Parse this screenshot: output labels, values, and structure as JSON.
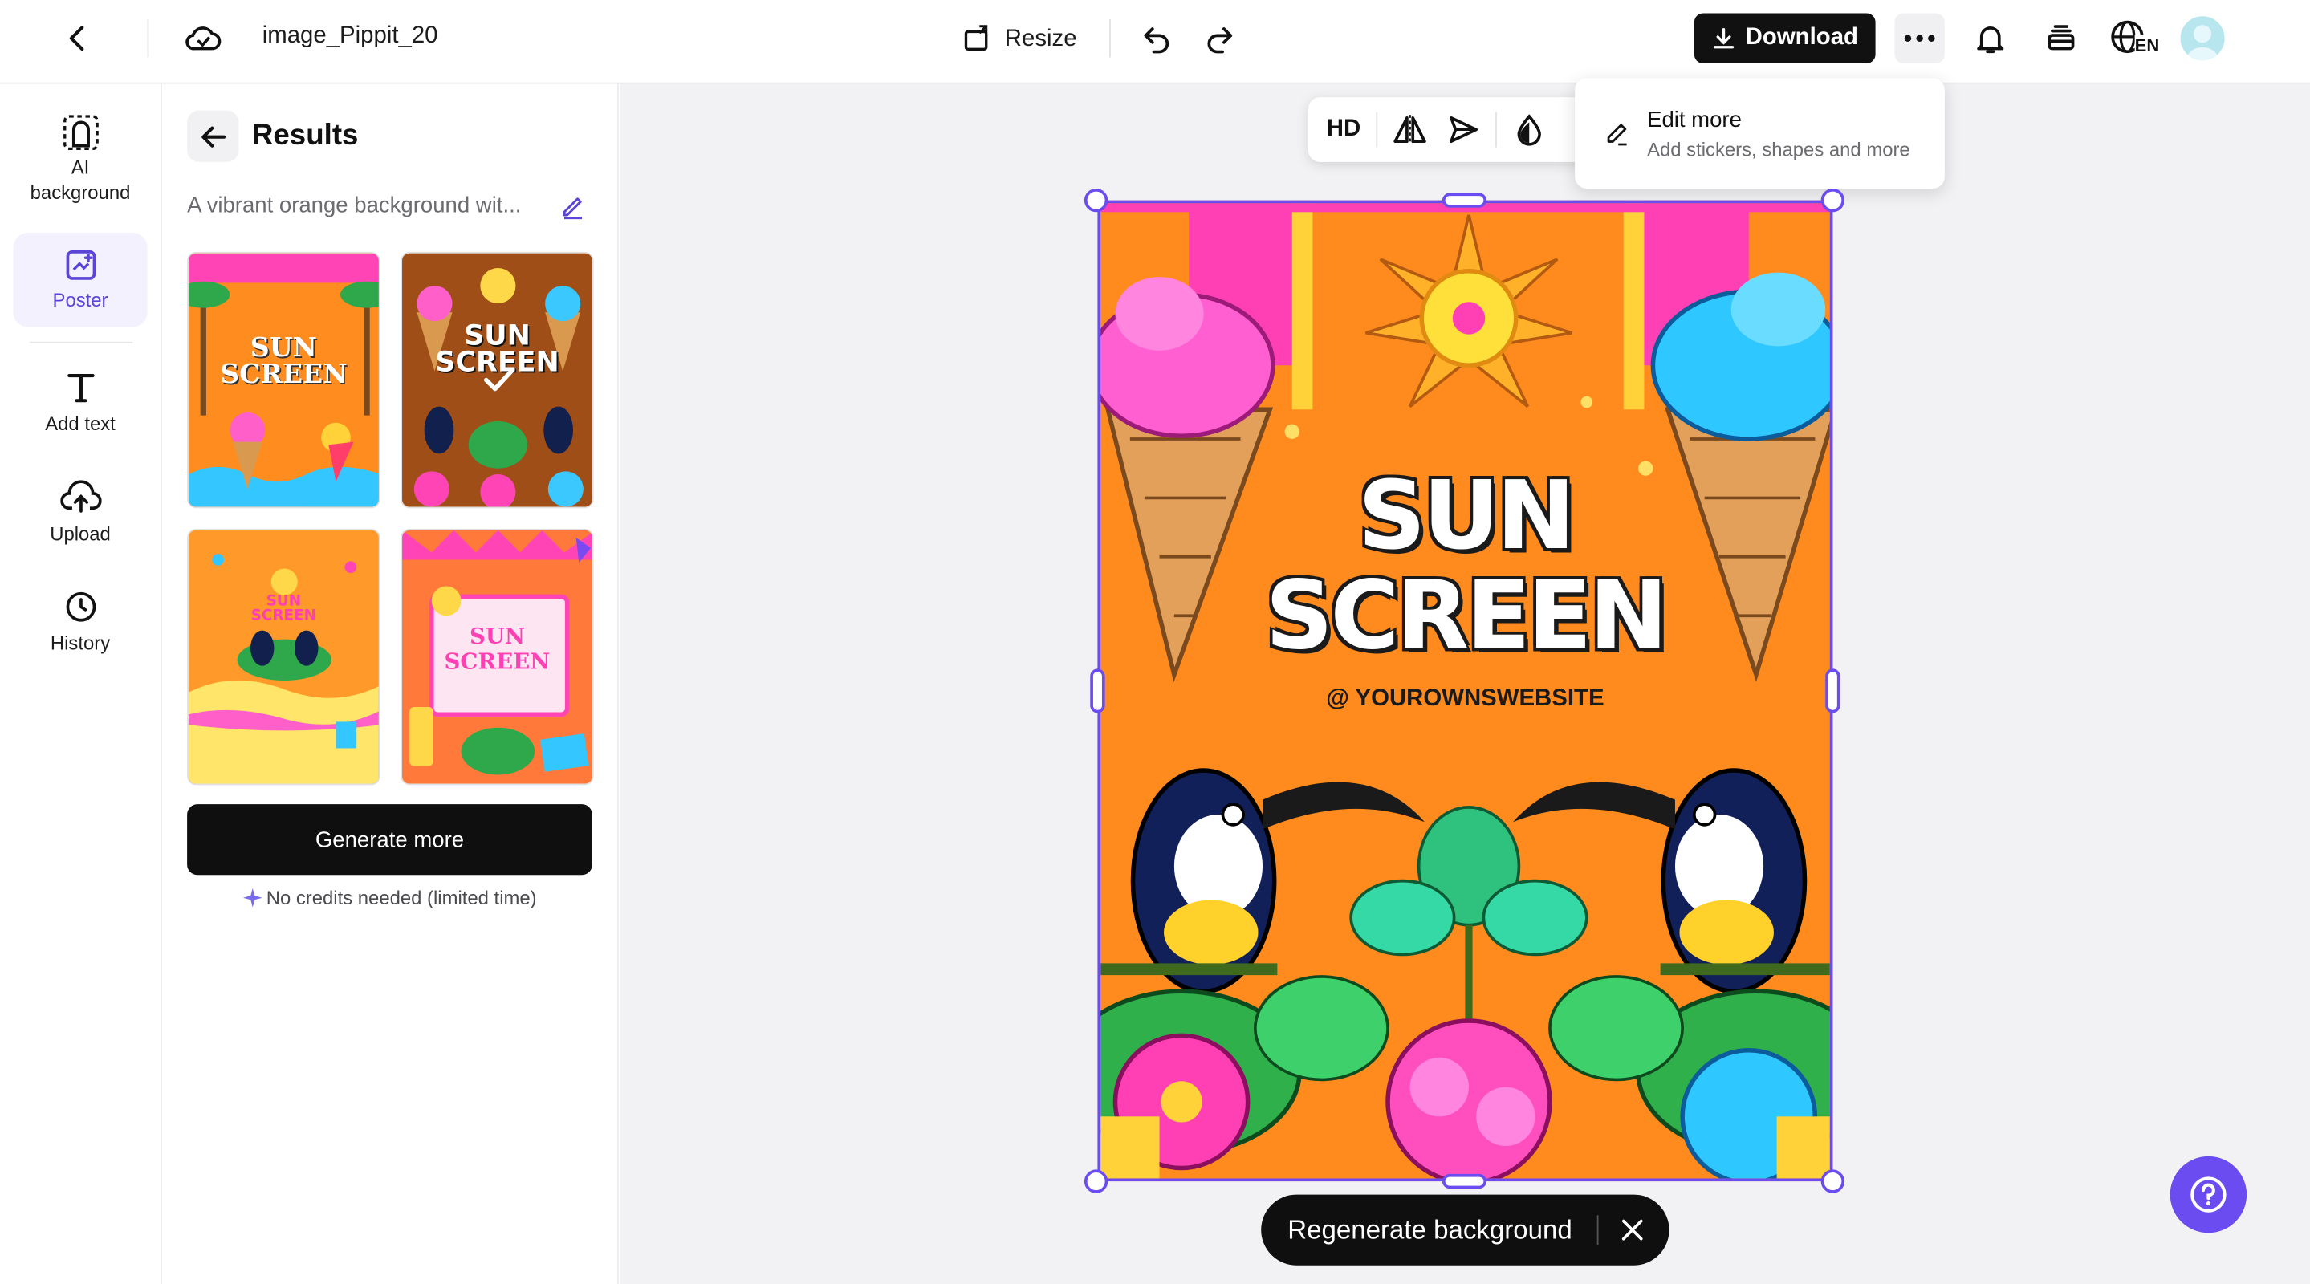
{
  "header": {
    "file_name": "image_Pippit_20",
    "resize_label": "Resize",
    "download_label": "Download",
    "lang_code": "EN"
  },
  "rail": {
    "items": [
      {
        "label": "AI background",
        "icon": "ai-background-icon"
      },
      {
        "label": "Poster",
        "icon": "poster-icon",
        "active": true
      },
      {
        "label": "Add text",
        "icon": "text-icon"
      },
      {
        "label": "Upload",
        "icon": "upload-icon"
      },
      {
        "label": "History",
        "icon": "history-icon"
      }
    ]
  },
  "panel": {
    "title": "Results",
    "prompt": "A vibrant orange background wit...",
    "generate_label": "Generate more",
    "credits_note": "No credits needed (limited time)",
    "thumbnails": [
      {
        "title_line1": "SUN",
        "title_line2": "SCREEN",
        "selected": false
      },
      {
        "title_line1": "SUN",
        "title_line2": "SCREEN",
        "selected": true
      },
      {
        "title_line1": "SUN",
        "title_line2": "SCREEN",
        "selected": false
      },
      {
        "title_line1": "SUN",
        "title_line2": "SCREEN",
        "selected": false
      }
    ]
  },
  "toolbar": {
    "hd_label": "HD"
  },
  "more_menu": {
    "item_title": "Edit more",
    "item_subtitle": "Add stickers, shapes and more"
  },
  "poster": {
    "title_line1": "SUN",
    "title_line2": "SCREEN",
    "subtitle": "@ YOUROWNSWEBSITE"
  },
  "regenerate": {
    "label": "Regenerate background"
  },
  "colors": {
    "accent": "#6a4cf0",
    "poster_orange": "#ff8a1d",
    "poster_pink": "#ff3fb4",
    "poster_blue": "#2fc4ff"
  }
}
